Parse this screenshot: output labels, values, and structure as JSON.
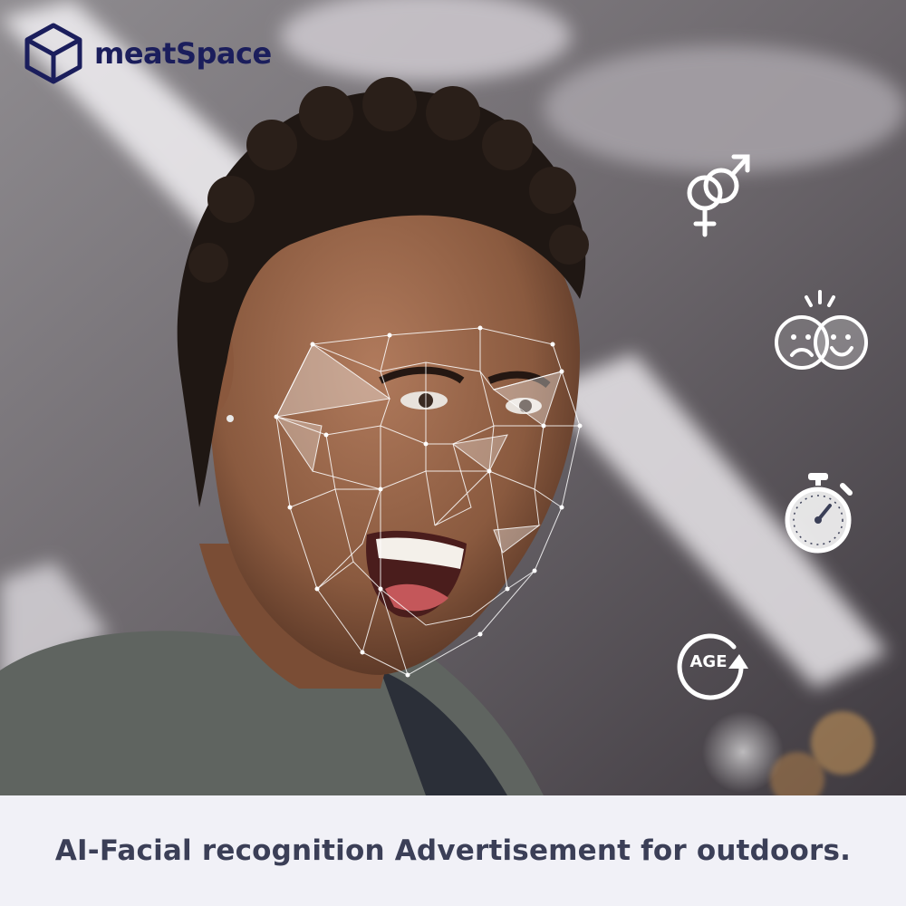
{
  "brand": {
    "name": "meatSpace",
    "color": "#1b1e5c",
    "logo_icon": "cube-icon"
  },
  "icons": [
    {
      "name": "gender-icon"
    },
    {
      "name": "emotion-icon"
    },
    {
      "name": "stopwatch-icon"
    },
    {
      "name": "age-icon",
      "label": "AGE"
    }
  ],
  "caption": {
    "text": "AI-Facial recognition Advertisement for outdoors.",
    "color": "#3b3f57",
    "background": "#f1f1f7"
  }
}
